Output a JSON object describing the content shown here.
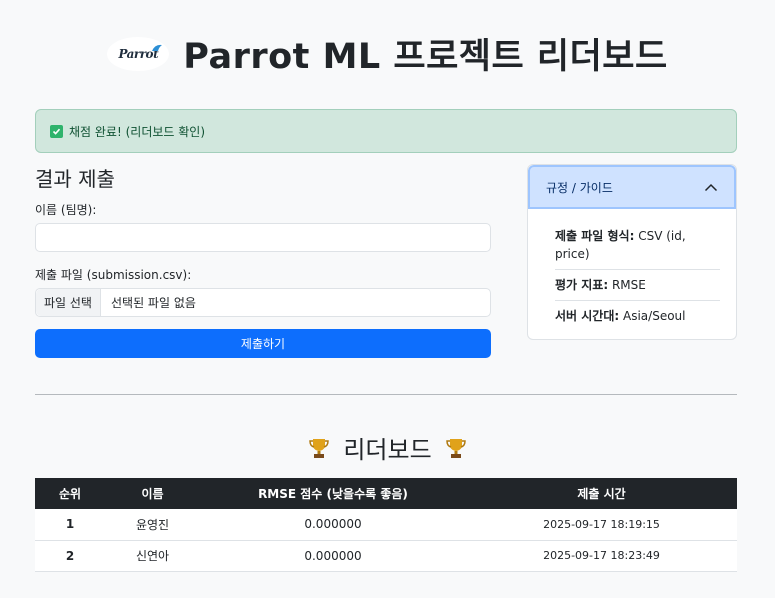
{
  "header": {
    "logo_text": "Parrot",
    "title": "Parrot ML 프로젝트 리더보드"
  },
  "alert": {
    "message": "채점 완료! (리더보드 확인)"
  },
  "form": {
    "section_title": "결과 제출",
    "name_label": "이름 (팀명):",
    "name_value": "",
    "file_label": "제출 파일 (submission.csv):",
    "file_button": "파일 선택",
    "file_status": "선택된 파일 없음",
    "submit_label": "제출하기"
  },
  "guide": {
    "title": "규정 / 가이드",
    "items": [
      {
        "key": "제출 파일 형식:",
        "value": "CSV (id, price)"
      },
      {
        "key": "평가 지표:",
        "value": "RMSE"
      },
      {
        "key": "서버 시간대:",
        "value": "Asia/Seoul"
      }
    ]
  },
  "leaderboard": {
    "title": "리더보드",
    "columns": [
      "순위",
      "이름",
      "RMSE 점수 (낮을수록 좋음)",
      "제출 시간"
    ],
    "rows": [
      {
        "rank": "1",
        "name": "윤영진",
        "score": "0.000000",
        "time": "2025-09-17 18:19:15"
      },
      {
        "rank": "2",
        "name": "신연아",
        "score": "0.000000",
        "time": "2025-09-17 18:23:49"
      }
    ]
  },
  "colors": {
    "primary": "#0d6efd",
    "success_bg": "#d1e7dd",
    "header_dark": "#212529",
    "guide_header": "#cfe2ff"
  },
  "icons": {
    "alert": "check-icon",
    "guide_toggle": "chevron-up-icon",
    "leaderboard": "trophy-icon"
  }
}
